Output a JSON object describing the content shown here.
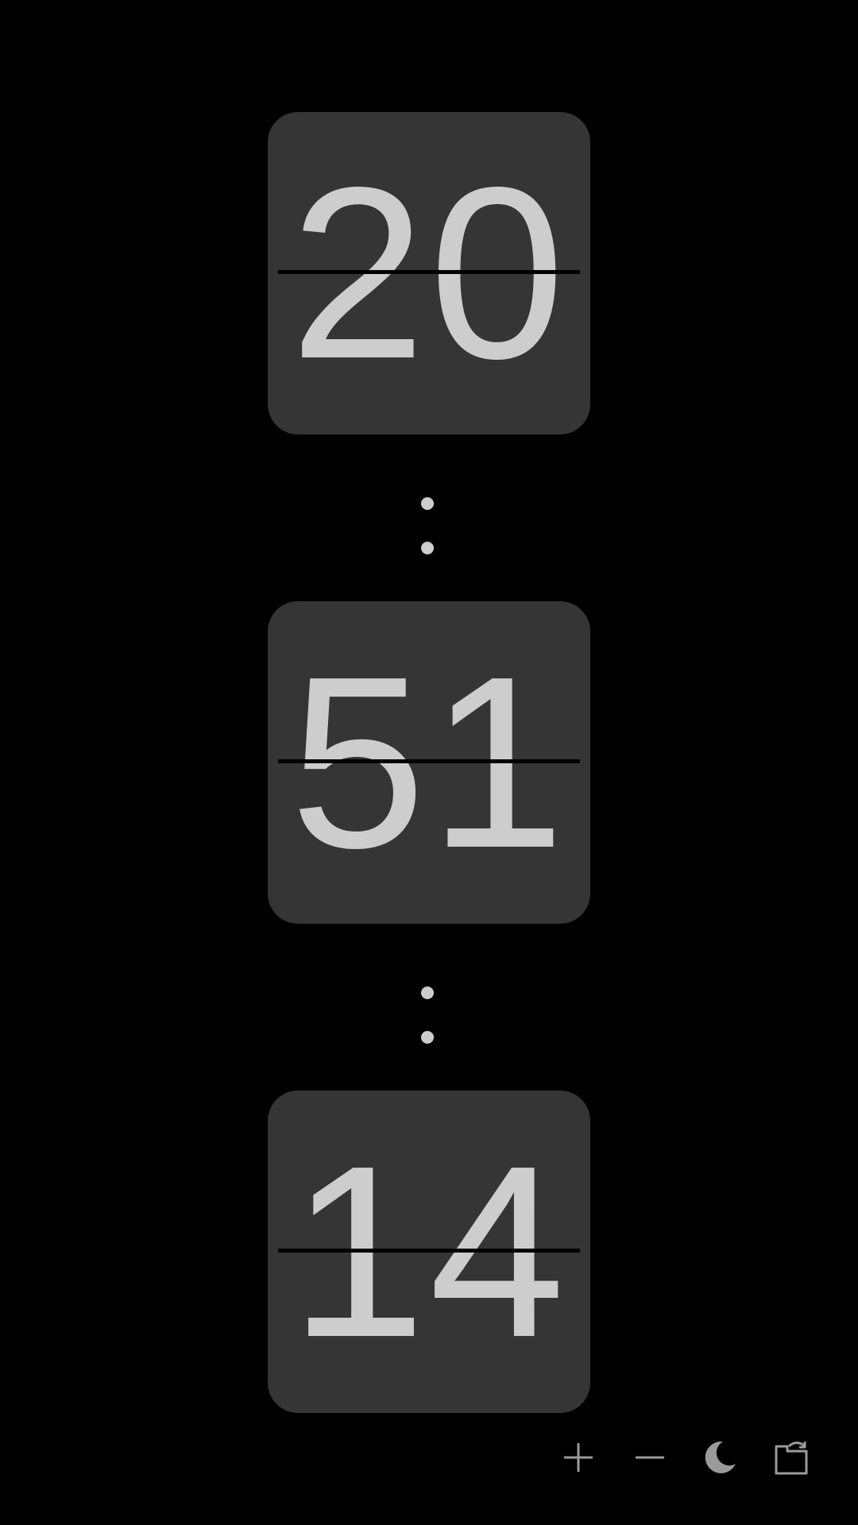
{
  "clock": {
    "hours": "20",
    "minutes": "51",
    "seconds": "14"
  },
  "controls": [
    {
      "name": "plus-icon",
      "label": "increase-size"
    },
    {
      "name": "minus-icon",
      "label": "decrease-size"
    },
    {
      "name": "moon-icon",
      "label": "night-mode"
    },
    {
      "name": "rotate-screen-icon",
      "label": "rotate-screen"
    }
  ],
  "colors": {
    "background": "#000000",
    "card": "#353535",
    "digits": "#cdcdcd",
    "icons": "#9a9a9a"
  }
}
